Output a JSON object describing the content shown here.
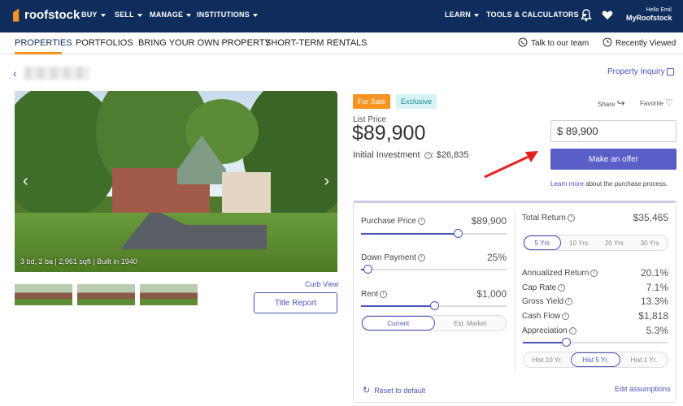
{
  "header": {
    "logo": "roofstock",
    "nav": [
      "BUY",
      "SELL",
      "MANAGE",
      "INSTITUTIONS"
    ],
    "right_nav": [
      "LEARN",
      "TOOLS & CALCULATORS"
    ],
    "hello": "Hello Emil",
    "account": "MyRoofstock",
    "bg_color": "#0f2d5c"
  },
  "subnav": {
    "items": [
      "PROPERTIES",
      "PORTFOLIOS",
      "BRING YOUR OWN PROPERTY",
      "SHORT-TERM RENTALS"
    ],
    "talk": "Talk to our team",
    "recent": "Recently Viewed"
  },
  "property": {
    "inquiry": "Property Inquiry",
    "caption": "3 bd, 2 ba | 2,961 sqft | Built in 1940",
    "curb_view": "Curb View",
    "title_report": "Title Report",
    "badge_sale": "For Sale",
    "badge_exclusive": "Exclusive",
    "share": "Share",
    "favorite": "Favorite",
    "list_price_label": "List Price",
    "list_price": "$89,900",
    "initial_investment_label": "Initial Investment",
    "initial_investment": ": $26,835"
  },
  "offer": {
    "input_value": "$  89,900",
    "button": "Make an offer",
    "learn_more": "Learn more",
    "learn_rest": " about the purchase process."
  },
  "calculator": {
    "purchase_price_label": "Purchase Price",
    "purchase_price": "$89,900",
    "purchase_price_level": 0.67,
    "down_payment_label": "Down Payment",
    "down_payment": "25%",
    "down_payment_level": 0.05,
    "rent_label": "Rent",
    "rent": "$1,000",
    "rent_level": 0.51,
    "rent_tabs": [
      "Current",
      "Est. Market"
    ],
    "total_return_label": "Total Return",
    "total_return": "$35,465",
    "year_tabs": [
      "5 Yrs",
      "10 Yrs",
      "20 Yrs",
      "30 Yrs"
    ],
    "metrics": [
      {
        "label": "Annualized Return",
        "value": "20.1%"
      },
      {
        "label": "Cap Rate",
        "value": "7.1%"
      },
      {
        "label": "Gross Yield",
        "value": "13.3%"
      },
      {
        "label": "Cash Flow",
        "value": "$1,818"
      },
      {
        "label": "Appreciation",
        "value": "5.3%"
      }
    ],
    "appreciation_level": 0.3,
    "hist_tabs": [
      "Hist 10 Yr.",
      "Hist 5 Yr.",
      "Hist 1 Yr."
    ],
    "reset": "Reset to default",
    "edit": "Edit assumptions"
  }
}
